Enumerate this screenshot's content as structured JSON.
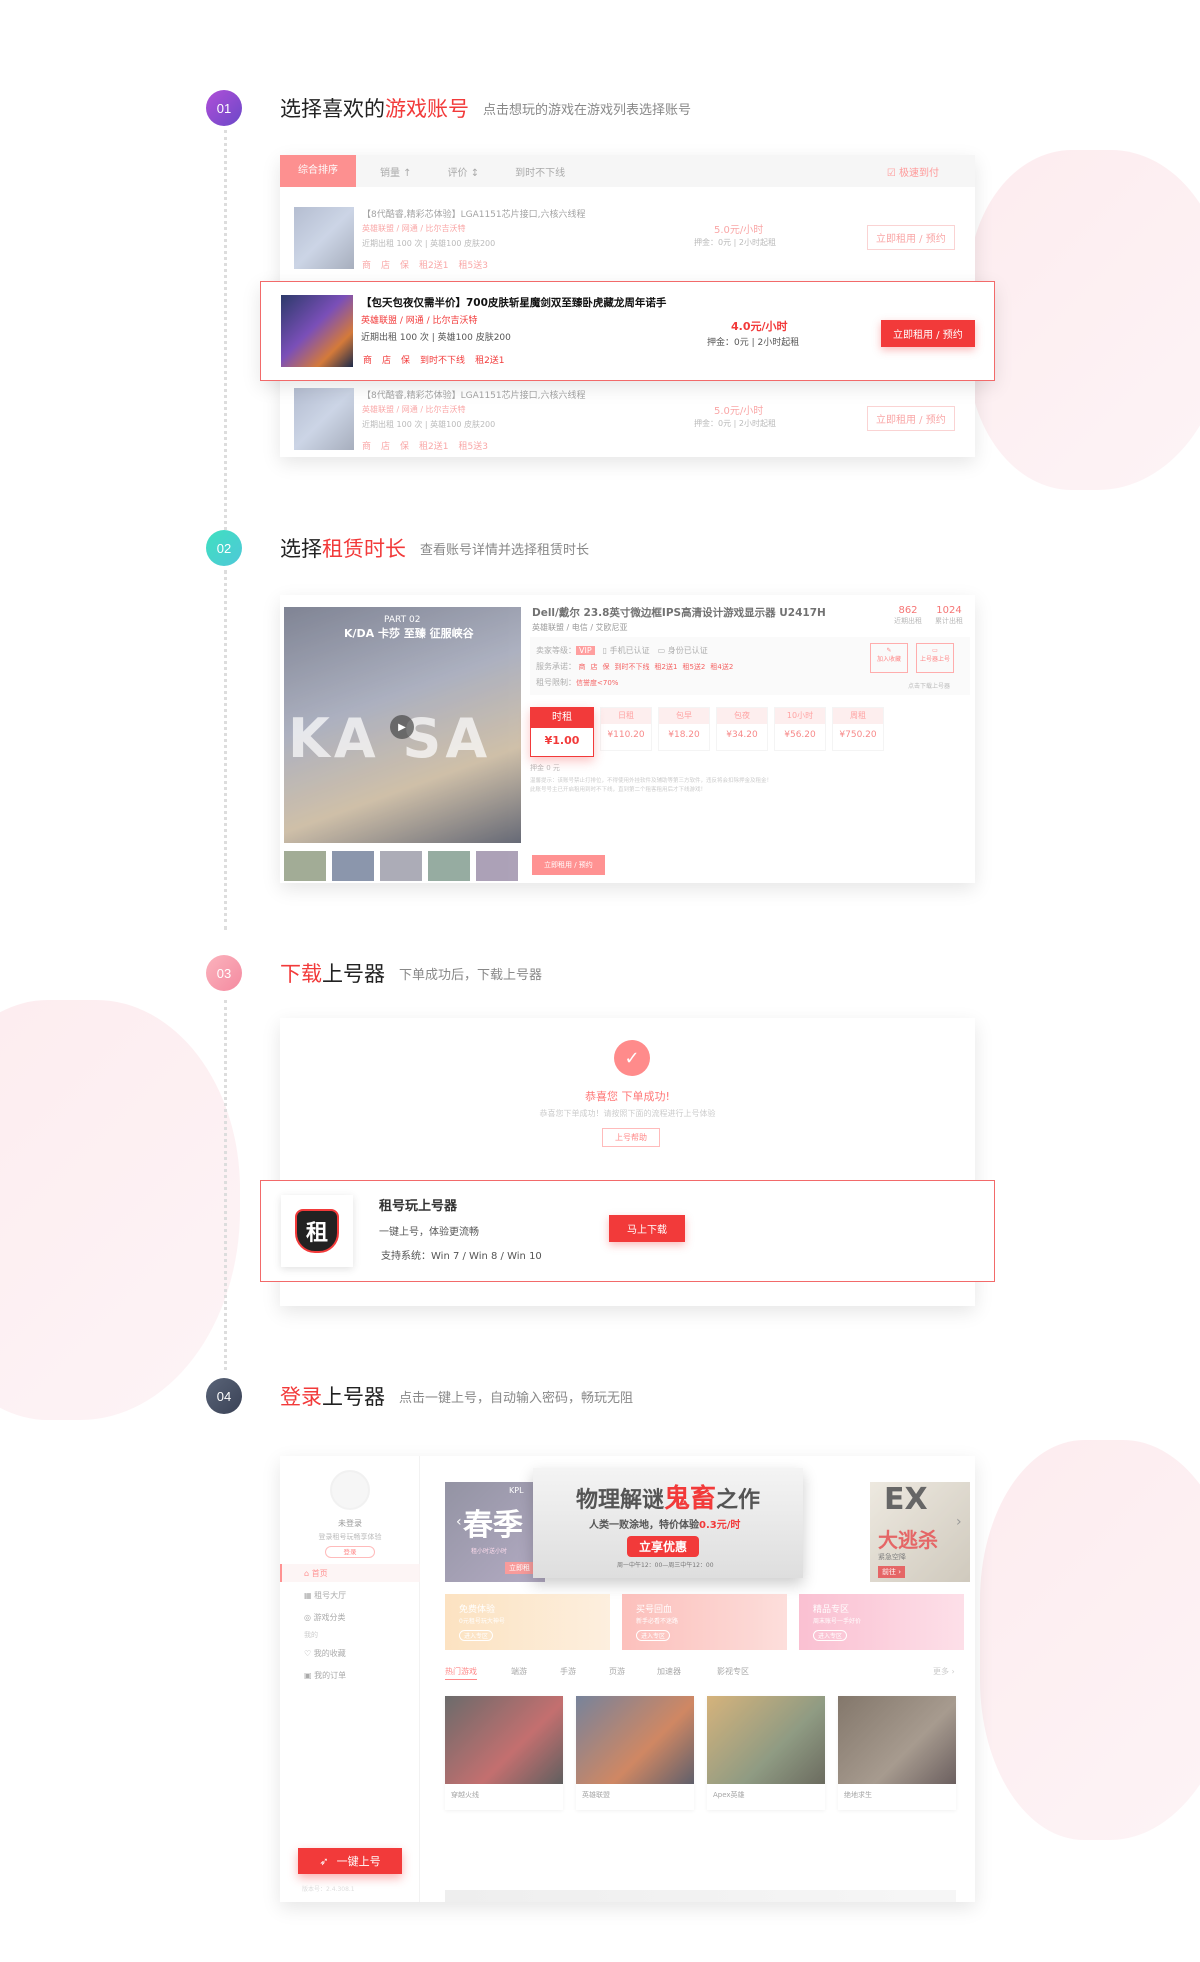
{
  "steps": [
    {
      "num": "01",
      "title_a": "选择喜欢的",
      "title_hl": "游戏账号",
      "sub": "点击想玩的游戏在游戏列表选择账号",
      "color": "#8a4fd0"
    },
    {
      "num": "02",
      "title_a": "选择",
      "title_hl": "租赁时长",
      "sub": "查看账号详情并选择租赁时长",
      "color": "#3fd6c4"
    },
    {
      "num": "03",
      "title_hl": "下载",
      "title_b": "上号器",
      "sub": "下单成功后，下载上号器",
      "color": "#f58fa0"
    },
    {
      "num": "04",
      "title_hl": "登录",
      "title_b": "上号器",
      "sub": "点击一键上号，自动输入密码，畅玩无阻",
      "color": "#4a5268"
    }
  ],
  "list": {
    "sort_tabs": [
      "综合排序",
      "销量 ↑",
      "评价 ↕",
      "到时不下线"
    ],
    "right_check": "极速到付",
    "faded_item": {
      "title": "【8代酷睿,精彩芯体验】LGA1151芯片接口,六核六线程",
      "game": "英雄联盟 / 网通 / 比尔吉沃特",
      "stats": "近期出租 100 次 | 英雄100 皮肤200",
      "tags": [
        "商",
        "店",
        "保",
        "租2送1",
        "租5送3"
      ],
      "price": "5.0元/小时",
      "deposit": "押金：0元 | 2小时起租",
      "btn": "立即租用 / 预约"
    },
    "highlight": {
      "title": "【包天包夜仅需半价】700皮肤斩星魔剑双至臻卧虎藏龙周年诺手",
      "game": "英雄联盟 / 网通 / 比尔吉沃特",
      "stats": "近期出租 100 次 | 英雄100 皮肤200",
      "tags": [
        "商",
        "店",
        "保",
        "到时不下线",
        "租2送1"
      ],
      "price": "4.0元/小时",
      "deposit": "押金：0元 | 2小时起租",
      "btn": "立即租用 / 预约"
    }
  },
  "detail": {
    "banner_part": "PART 02",
    "banner_title": "K/DA 卡莎 至臻 征服峡谷",
    "title": "Dell/戴尔 23.8英寸微边框IPS高清设计游戏显示器 U2417H",
    "sub": "英雄联盟 / 电信 / 艾欧尼亚",
    "stat1_val": "862",
    "stat1_lbl": "近期出租",
    "stat2_val": "1024",
    "stat2_lbl": "累计出租",
    "seller": "卖家等级：",
    "phone": "手机已认证",
    "id": "身份已认证",
    "service": "服务承诺：",
    "services": [
      "商",
      "店",
      "保",
      "到时不下线",
      "租2送1",
      "租5送2",
      "租4送2"
    ],
    "limit": "租号限制：",
    "limit_val": "信誉度<70%",
    "fav": "加入收藏",
    "onboard": "上号器上号",
    "online": "点击下载上号器",
    "prices": [
      {
        "label": "时租",
        "val": "¥1.00"
      },
      {
        "label": "日租",
        "val": "¥110.20"
      },
      {
        "label": "包早",
        "val": "¥18.20"
      },
      {
        "label": "包夜",
        "val": "¥34.20"
      },
      {
        "label": "10小时",
        "val": "¥56.20"
      },
      {
        "label": "周租",
        "val": "¥750.20"
      }
    ],
    "deposit": "押金 0 元",
    "tips1": "温馨提示：该账号禁止打排位，不得使用外挂软件及辅助等第三方软件，违反将会扣除押金及租金！",
    "tips2": "此账号号主已开启租用到时不下线，直到第二个租客租用后才下线游戏！",
    "btn": "立即租用 / 预约"
  },
  "download": {
    "success": "恭喜您 下单成功!",
    "success_sub": "恭喜您下单成功！请按照下面的流程进行上号体验",
    "help_btn": "上号帮助",
    "app_name": "租号玩上号器",
    "app_logo": "租",
    "desc": "一键上号，体验更流畅",
    "sys": "支持系统：Win 7 / Win 8 / Win 10",
    "btn": "马上下载"
  },
  "launcher": {
    "user": "未登录",
    "user_sub": "登录租号玩畅享体验",
    "login": "登录",
    "nav": [
      "首页",
      "租号大厅",
      "游戏分类",
      "我的",
      "我的收藏",
      "我的订单"
    ],
    "banner_l": "春季",
    "banner_l_kpl": "KPL",
    "banner_l_sub": "租小时送小时",
    "banner_l_btn": "立即租",
    "banner_c": "物理解谜",
    "banner_c_hl": "鬼畜",
    "banner_c_tail": "之作",
    "banner_c_sub": "人类一败涂地，特价体验",
    "banner_c_price": "0.3元/时",
    "banner_c_btn": "立享优惠",
    "banner_c_time": "周一中午12：00—周三中午12：00",
    "banner_r": "EX",
    "banner_r_2": "大逃杀",
    "banner_r_sub": "紧急空降",
    "banner_r_btn": "前往 ›",
    "promos": [
      {
        "title": "免费体验",
        "sub": "0元租号玩大神号",
        "btn": "进入专区"
      },
      {
        "title": "买号回血",
        "sub": "新手必看不迷路",
        "btn": "进入专区"
      },
      {
        "title": "精品专区",
        "sub": "周末账号一手好价",
        "btn": "进入专区"
      }
    ],
    "tabs": [
      "热门游戏",
      "端游",
      "手游",
      "页游",
      "加速器",
      "影视专区"
    ],
    "more": "更多 ›",
    "games": [
      "穿越火线",
      "英雄联盟",
      "Apex英雄",
      "绝地求生"
    ],
    "launch_btn": "一键上号",
    "version": "版本号：2.4.308.1"
  },
  "colors": {
    "accent": "#f23a3a",
    "light": "#fdecef"
  }
}
